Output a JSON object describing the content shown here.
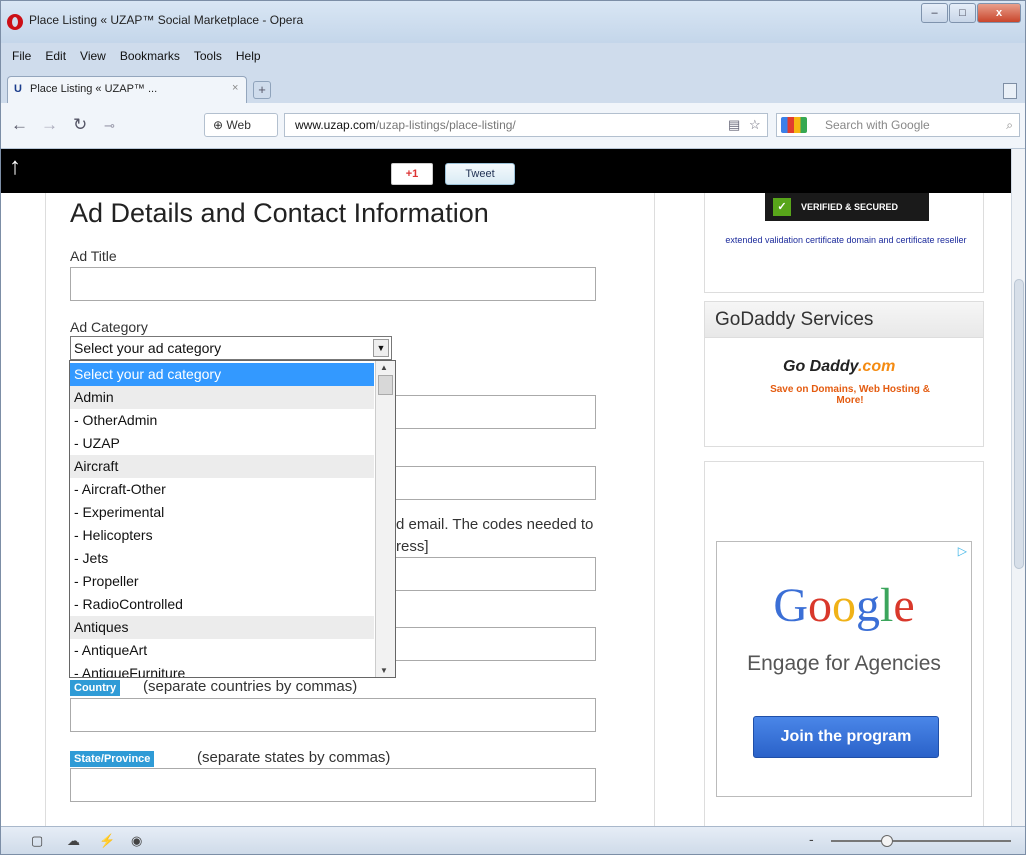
{
  "window": {
    "title": "Place Listing « UZAP™ Social Marketplace - Opera",
    "minimize": "–",
    "maximize": "□",
    "close": "x"
  },
  "menu": [
    "File",
    "Edit",
    "View",
    "Bookmarks",
    "Tools",
    "Help"
  ],
  "tab": {
    "favicon": "U",
    "label": "Place Listing « UZAP™ ...",
    "close": "×",
    "new": "+"
  },
  "nav": {
    "web_label": "Web",
    "url_domain": "www.uzap.com",
    "url_path": "/uzap-listings/place-listing/",
    "search_placeholder": "Search with Google"
  },
  "share": {
    "gplus": "+1",
    "tweet": "Tweet"
  },
  "form": {
    "title": "Ad Details and Contact Information",
    "ad_title_label": "Ad Title",
    "ad_category_label": "Ad Category",
    "select_value": "Select your ad category",
    "obscured_text_line1": "d email. The codes needed to",
    "obscured_text_line2": "ress]",
    "country_tag": "Country",
    "country_note": "(separate countries by commas)",
    "state_tag": "State/Province",
    "state_note": "(separate states by commas)"
  },
  "dropdown": {
    "options": [
      {
        "label": "Select your ad category",
        "kind": "selected"
      },
      {
        "label": "Admin",
        "kind": "group"
      },
      {
        "label": "- OtherAdmin",
        "kind": "item"
      },
      {
        "label": "- UZAP",
        "kind": "item"
      },
      {
        "label": "Aircraft",
        "kind": "group"
      },
      {
        "label": "- Aircraft-Other",
        "kind": "item"
      },
      {
        "label": "- Experimental",
        "kind": "item"
      },
      {
        "label": "- Helicopters",
        "kind": "item"
      },
      {
        "label": "- Jets",
        "kind": "item"
      },
      {
        "label": "- Propeller",
        "kind": "item"
      },
      {
        "label": "- RadioControlled",
        "kind": "item"
      },
      {
        "label": "Antiques",
        "kind": "group"
      },
      {
        "label": "- AntiqueArt",
        "kind": "item"
      },
      {
        "label": "- AntiqueFurniture",
        "kind": "item"
      }
    ]
  },
  "sidebar": {
    "verified_badge": "VERIFIED & SECURED",
    "verified_text": "extended validation certificate domain and certificate reseller",
    "godaddy_title": "GoDaddy Services",
    "godaddy_logo_a": "Go Daddy",
    "godaddy_logo_b": ".com",
    "godaddy_tagline": "Save on Domains, Web Hosting & More!",
    "ad_brand": "Google",
    "ad_subtitle": "Engage for Agencies",
    "ad_button": "Join the program"
  },
  "colors": {
    "accent_tag": "#2f9bd6",
    "selected_option": "#3399ff",
    "ad_button": "#2a62c9"
  }
}
